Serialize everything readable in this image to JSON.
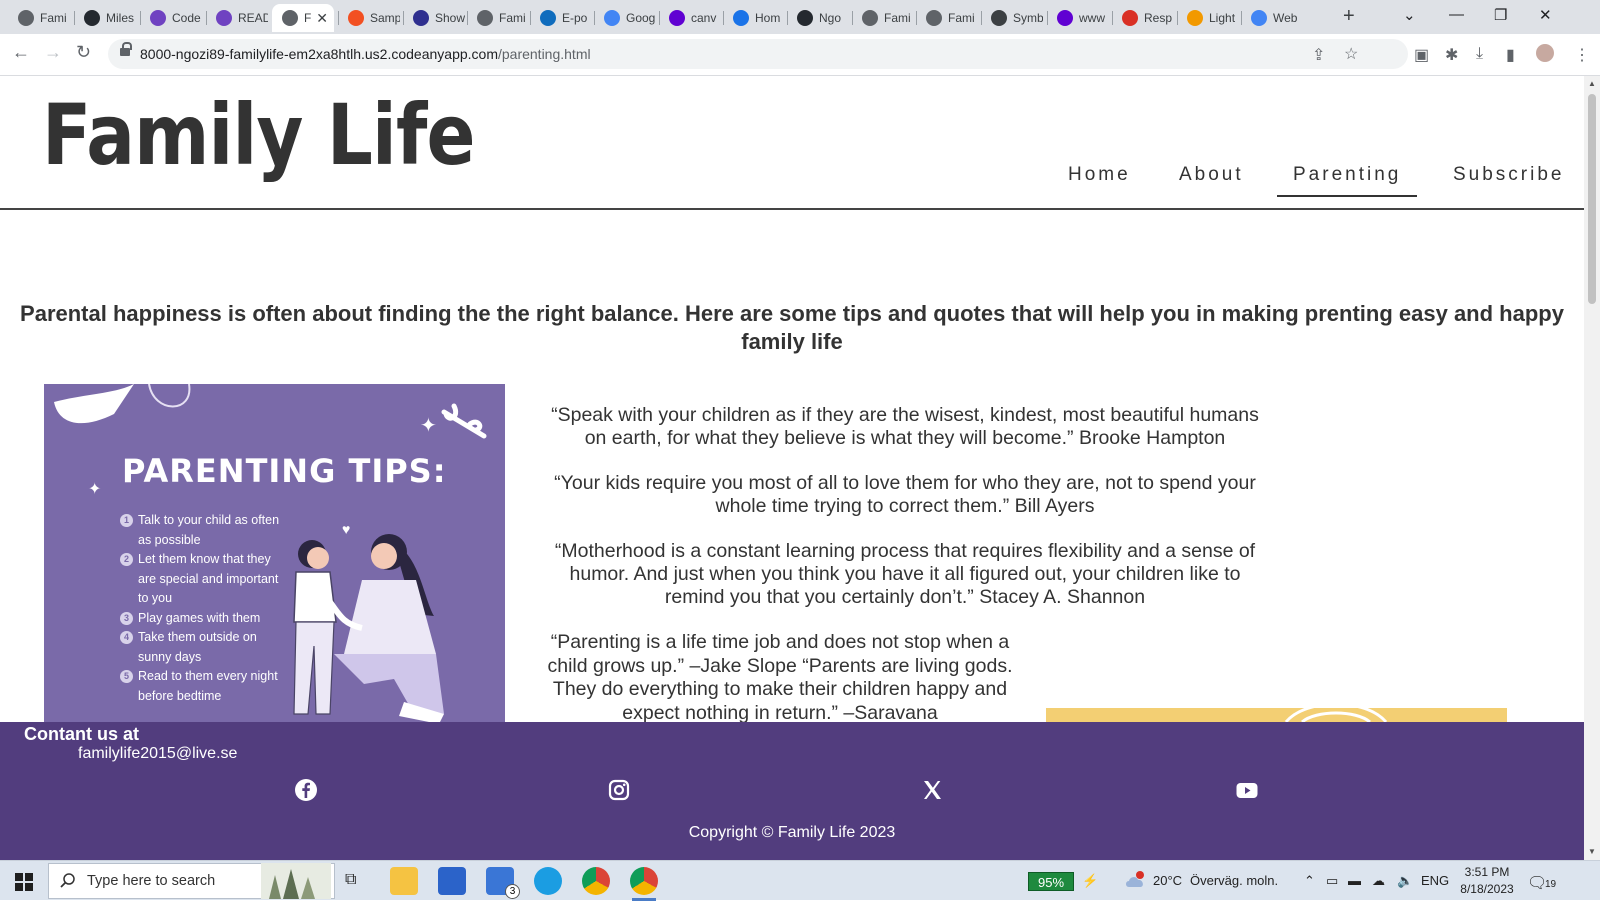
{
  "browser": {
    "tabs": [
      {
        "label": "Fami",
        "icon": "globe-icon",
        "color": "#5f6368"
      },
      {
        "label": "Miles",
        "icon": "github-icon",
        "color": "#24292f"
      },
      {
        "label": "Code",
        "icon": "cube-icon",
        "color": "#6f42c1"
      },
      {
        "label": "READ",
        "icon": "cube-icon",
        "color": "#6f42c1"
      },
      {
        "label": "F",
        "icon": "globe-icon",
        "color": "#5f6368",
        "active": true
      },
      {
        "label": "Samp",
        "icon": "circle-icon",
        "color": "#f25022"
      },
      {
        "label": "Show",
        "icon": "logo-icon",
        "color": "#2f2f8f"
      },
      {
        "label": "Fami",
        "icon": "globe-icon",
        "color": "#5f6368"
      },
      {
        "label": "E-po",
        "icon": "outlook-icon",
        "color": "#0f6cbd"
      },
      {
        "label": "Goog",
        "icon": "translate-icon",
        "color": "#4285f4"
      },
      {
        "label": "canv",
        "icon": "yahoo-icon",
        "color": "#6001d2"
      },
      {
        "label": "Hom",
        "icon": "c-icon",
        "color": "#1a73e8"
      },
      {
        "label": "Ngo",
        "icon": "github-icon",
        "color": "#24292f"
      },
      {
        "label": "Fami",
        "icon": "globe-icon",
        "color": "#5f6368"
      },
      {
        "label": "Fami",
        "icon": "globe-icon",
        "color": "#5f6368"
      },
      {
        "label": "Symb",
        "icon": "smiley-icon",
        "color": "#3c4043"
      },
      {
        "label": "www",
        "icon": "yahoo-icon",
        "color": "#6001d2"
      },
      {
        "label": "Resp",
        "icon": "a-icon",
        "color": "#d93025"
      },
      {
        "label": "Light",
        "icon": "lighthouse-icon",
        "color": "#f29900"
      },
      {
        "label": "Web",
        "icon": "google-icon",
        "color": "#4285f4"
      }
    ],
    "url_host": "8000-ngozi89-familylife-em2xa8htlh.us2.codeanyapp.com",
    "url_path": "/parenting.html"
  },
  "site": {
    "logo": "Family Life",
    "nav": [
      {
        "label": "Home"
      },
      {
        "label": "About"
      },
      {
        "label": "Parenting",
        "active": true
      },
      {
        "label": "Subscribe"
      }
    ],
    "intro": "Parental happiness is often about finding the the right balance. Here are some tips and quotes that will help you in making prenting easy and happy family life",
    "tips_card": {
      "title": "PARENTING TIPS:",
      "items": [
        "Talk to your child as often as possible",
        "Let them know that they are special and important to you",
        "Play games with them",
        "Take them outside on sunny days",
        "Read to them every night before bedtime"
      ],
      "accent_color": "#7a6aa9"
    },
    "quotes": [
      "“Speak with your children as if they are the wisest, kindest, most beautiful humans on earth, for what they believe is what they will become.” Brooke Hampton",
      "“Your kids require you most of all to love them for who they are, not to spend your whole time trying to correct them.” Bill Ayers",
      "“Motherhood is a constant learning process that requires flexibility and a sense of humor. And just when you think you have it all figured out, your children like to remind you that you certainly don’t.” Stacey A. Shannon"
    ],
    "quote_last": "“Parenting is a life time job and does not stop when a child grows up.” –Jake Slope “Parents are living gods. They do everything to make their children happy and expect nothing in return.” –Saravana",
    "footer": {
      "contact_title": "Contant us at",
      "email": "familylife2015@live.se",
      "social": [
        "facebook-icon",
        "instagram-icon",
        "x-icon",
        "youtube-icon"
      ],
      "copyright": "Copyright © Family Life 2023",
      "color": "#523d7e"
    }
  },
  "taskbar": {
    "search_placeholder": "Type here to search",
    "mail_badge": "3",
    "battery": "95%",
    "weather": "20°C",
    "weather_desc": "Överväg. moln.",
    "language": "ENG",
    "time": "3:51 PM",
    "date": "8/18/2023",
    "notifications": "19"
  }
}
